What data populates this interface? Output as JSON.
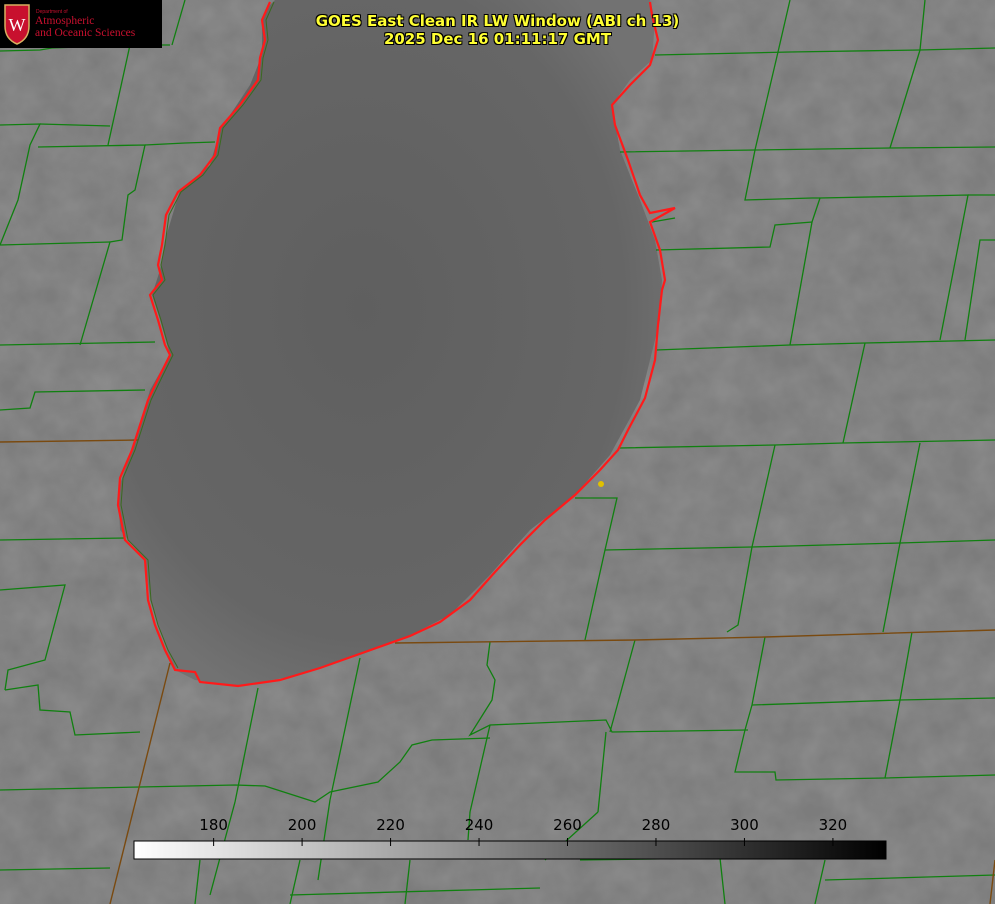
{
  "logo": {
    "small_text": "Department of",
    "line1": "Atmospheric",
    "line2": "and Oceanic Sciences",
    "emblem_icon": "uw-crest-icon",
    "seal_letter": "W"
  },
  "title": {
    "line1": "GOES East Clean IR LW Window (ABI ch 13)",
    "line2": "2025 Dec 16 01:11:17 GMT"
  },
  "colorbar": {
    "ticks": [
      180,
      200,
      220,
      240,
      260,
      280,
      300,
      320
    ],
    "range": [
      162,
      332
    ],
    "scale": "white-to-black"
  },
  "map": {
    "feature": "lake-outline",
    "colors": {
      "county_lines": "#108010",
      "state_lines": "#7a4a10",
      "lake_outline": "#ff1a1a",
      "marker": "#e0c000"
    }
  }
}
